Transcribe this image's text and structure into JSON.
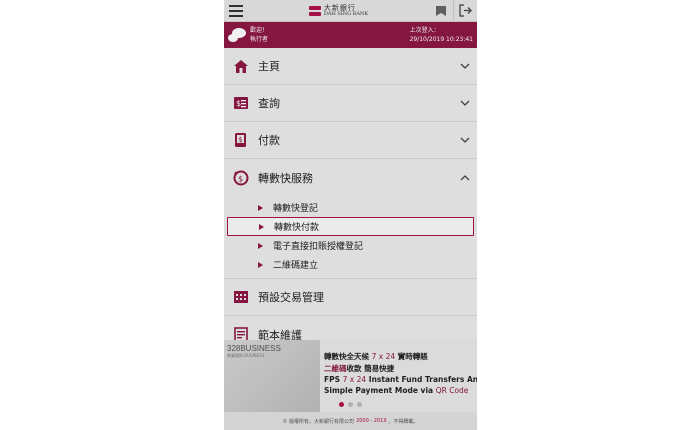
{
  "header": {
    "logo_cn": "大新銀行",
    "logo_en": "DAH SING BANK",
    "icons": [
      "hamburger-icon",
      "inbox-icon",
      "logout-icon"
    ]
  },
  "welcome": {
    "greeting": "歡迎！",
    "user": "執行者",
    "last_login_label": "上次登入：",
    "last_login_time": "29/10/2019 10:23:41"
  },
  "menu": {
    "items": [
      {
        "label": "主頁",
        "icon": "home-icon"
      },
      {
        "label": "查詢",
        "icon": "enquiry-icon"
      },
      {
        "label": "付款",
        "icon": "payment-icon"
      },
      {
        "label": "轉數快服務",
        "icon": "fps-icon"
      }
    ],
    "fps_sub": [
      {
        "label": "轉數快登記"
      },
      {
        "label": "轉數快付款"
      },
      {
        "label": "電子直接扣賬授權登記"
      },
      {
        "label": "二維碼建立"
      }
    ],
    "items2": [
      {
        "label": "預設交易管理",
        "icon": "calendar-icon"
      },
      {
        "label": "範本維護",
        "icon": "template-icon"
      }
    ]
  },
  "banner": {
    "brand": "328BUSINESS",
    "brand_sub": "商業理財 BUSINESS",
    "line1a": "轉數快全天候 ",
    "line1b": "7 x 24",
    "line1c": " 實時轉賬",
    "line2a": "二維碼",
    "line2b": "收款  簡易快捷",
    "line3a": "FPS ",
    "line3b": "7 x 24",
    "line3c": " Instant Fund Transfers Anytime",
    "line4a": "Simple Payment Mode via ",
    "line4b": "QR Code"
  },
  "footer": {
    "text_a": "© 版權所有，大新銀行有限公司",
    "years": "2000 - 2019",
    "text_b": "。不得轉載。"
  },
  "colors": {
    "brand": "#8e1845",
    "accent": "#b0124d"
  }
}
